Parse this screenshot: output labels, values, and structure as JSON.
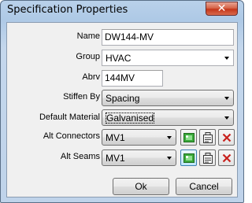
{
  "window": {
    "title": "Specification Properties",
    "close_glyph": "✕"
  },
  "form": {
    "name": {
      "label": "Name",
      "value": "DW144-MV"
    },
    "group": {
      "label": "Group",
      "value": "HVAC"
    },
    "abrv": {
      "label": "Abrv",
      "value": "144MV"
    },
    "stiffen_by": {
      "label": "Stiffen By",
      "value": "Spacing"
    },
    "default_material": {
      "label": "Default Material",
      "value": "Galvanised"
    },
    "alt_connectors": {
      "label": "Alt Connectors",
      "value": "MV1"
    },
    "alt_seams": {
      "label": "Alt Seams",
      "value": "MV1"
    }
  },
  "buttons": {
    "ok": "Ok",
    "cancel": "Cancel"
  },
  "icons": {
    "add": "add-item-icon",
    "properties": "properties-icon",
    "delete": "delete-icon"
  },
  "colors": {
    "title_bar": "#b9d1ea",
    "close_button": "#c4361a",
    "dialog_face": "#f0f0f0",
    "add_icon_green": "#3aa83a",
    "delete_icon_red": "#c8201c"
  }
}
